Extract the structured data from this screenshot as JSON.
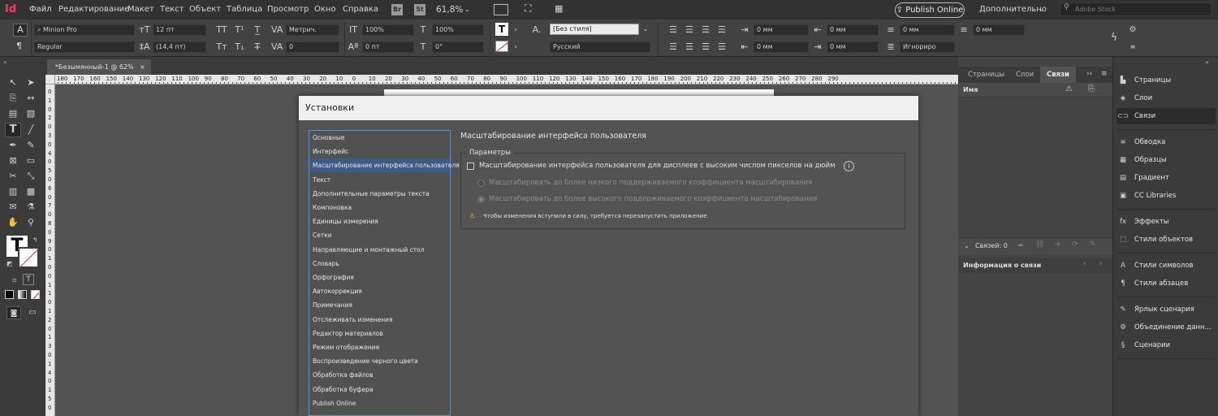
{
  "app": {
    "logo": "Id"
  },
  "menubar": {
    "items": [
      "Файл",
      "Редактирование",
      "Макет",
      "Текст",
      "Объект",
      "Таблица",
      "Просмотр",
      "Окно",
      "Справка"
    ],
    "bridge": "Br",
    "stock": "St",
    "zoom": "61,8%",
    "publish": "Publish Online",
    "workspace": "Дополнительно",
    "search_placeholder": "Adobe Stock"
  },
  "control": {
    "font_family": "Minion Pro",
    "font_style": "Regular",
    "font_size": "12 пт",
    "leading": "(14,4 пт)",
    "kerning": "Метрич.",
    "tracking": "0",
    "vscale": "100%",
    "hscale": "100%",
    "baseline": "0 пт",
    "skew": "0°",
    "char_style": "[Без стиля]",
    "language": "Русский",
    "indent_values": [
      "0 мм",
      "0 мм",
      "0 мм",
      "0 мм",
      "0 мм",
      "0 мм"
    ],
    "ignore": "Игнориро"
  },
  "document": {
    "tab": "*Безымянный-1 @ 62%",
    "close": "×"
  },
  "rulers": {
    "h_ticks": [
      "180",
      "170",
      "160",
      "150",
      "140",
      "130",
      "120",
      "110",
      "100",
      "90",
      "80",
      "70",
      "60",
      "50",
      "40",
      "30",
      "20",
      "10",
      "0",
      "10",
      "20",
      "30",
      "40",
      "50",
      "60",
      "70",
      "80",
      "90",
      "100",
      "110",
      "120",
      "130",
      "140",
      "150",
      "160",
      "170",
      "180",
      "190",
      "200",
      "210",
      "220",
      "230",
      "240",
      "250",
      "260",
      "270",
      "280",
      "290"
    ],
    "v_ticks": [
      "0",
      "1",
      "0",
      "2",
      "0",
      "3",
      "0",
      "4",
      "0",
      "5",
      "0",
      "6",
      "0",
      "7",
      "0",
      "8",
      "0",
      "9",
      "0",
      "1",
      "0",
      "0",
      "1",
      "1",
      "0",
      "1",
      "2",
      "0",
      "1",
      "3",
      "0",
      "1",
      "4",
      "0",
      "1",
      "5",
      "0"
    ]
  },
  "dialog": {
    "title": "Установки",
    "nav": [
      "Основные",
      "Интерфейс",
      "Масштабирование интерфейса пользователя",
      "Текст",
      "Дополнительные параметры текста",
      "Компоновка",
      "Единицы измерения",
      "Сетки",
      "Направляющие и монтажный стол",
      "Словарь",
      "Орфография",
      "Автокоррекция",
      "Примечания",
      "Отслеживать изменения",
      "Редактор материалов",
      "Режим отображения",
      "Воспроизведение черного цвета",
      "Обработка файлов",
      "Обработка буфера",
      "Publish Online"
    ],
    "selected_nav": "Масштабирование интерфейса пользователя",
    "section_title": "Масштабирование интерфейса пользователя",
    "group_label": "Параметры",
    "checkbox_label": "Масштабирование интерфейса пользователя для дисплеев с высоким числом пикселов на дюйм",
    "checkbox_checked": false,
    "radio_low": "Масштабировать до более низкого поддерживаемого коэффициента масштабирования",
    "radio_high": "Масштабировать до более высокого поддерживаемого коэффициента масштабирования",
    "radio_selected": "high",
    "warning": "Чтобы изменения вступили в силу, требуется перезапустить приложение."
  },
  "links_panel": {
    "tabs": [
      "Страницы",
      "Слои",
      "Связи"
    ],
    "active_tab": "Связи",
    "col_name": "Имя",
    "links_count": "Связей: 0",
    "info_title": "Информация о связи"
  },
  "dock": {
    "groups": [
      [
        {
          "icon": "pages-icon",
          "label": "Страницы"
        },
        {
          "icon": "layers-icon",
          "label": "Слои"
        },
        {
          "icon": "links-icon",
          "label": "Связи"
        }
      ],
      [
        {
          "icon": "stroke-icon",
          "label": "Обводка"
        },
        {
          "icon": "swatches-icon",
          "label": "Образцы"
        },
        {
          "icon": "gradient-icon",
          "label": "Градиент"
        },
        {
          "icon": "cc-libraries-icon",
          "label": "CC Libraries"
        }
      ],
      [
        {
          "icon": "effects-icon",
          "label": "Эффекты"
        },
        {
          "icon": "object-styles-icon",
          "label": "Стили объектов"
        }
      ],
      [
        {
          "icon": "character-styles-icon",
          "label": "Стили символов"
        },
        {
          "icon": "paragraph-styles-icon",
          "label": "Стили абзацев"
        }
      ],
      [
        {
          "icon": "script-label-icon",
          "label": "Ярлык сценария"
        },
        {
          "icon": "data-merge-icon",
          "label": "Объединение данн..."
        },
        {
          "icon": "scripts-icon",
          "label": "Сценарии"
        }
      ]
    ],
    "selected": "Связи"
  },
  "colors": {
    "accent_selection": "#3d5a88",
    "dialog_title_bg": "#f0f0f0",
    "warning": "#f2c200"
  }
}
